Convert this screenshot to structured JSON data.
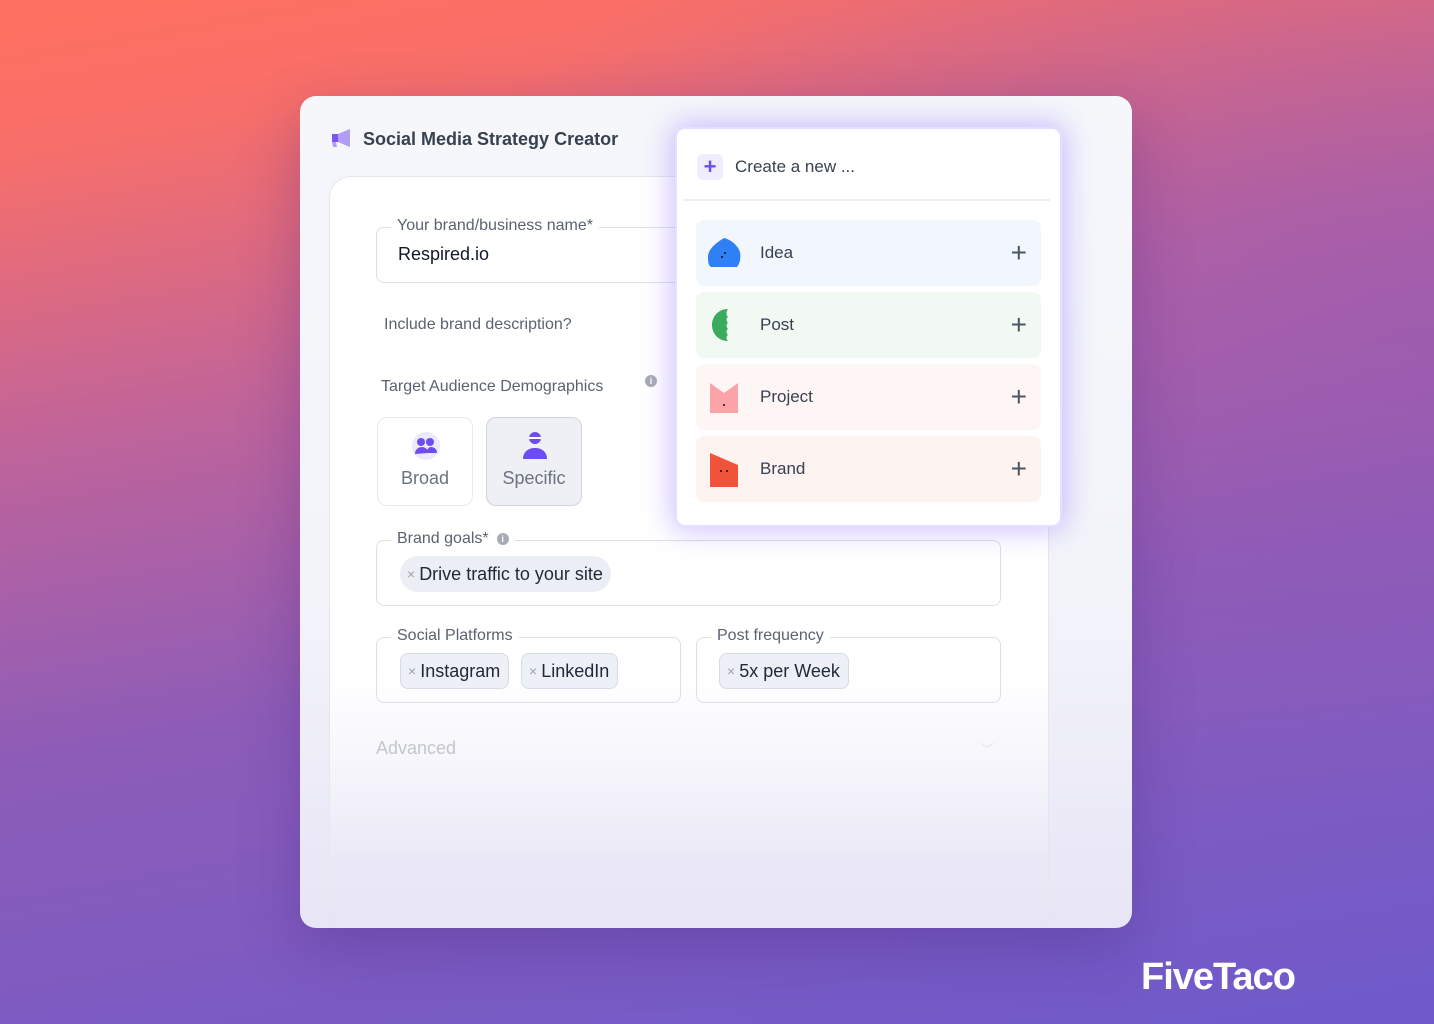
{
  "app": {
    "title": "Social Media Strategy Creator"
  },
  "form": {
    "brand_name": {
      "label": "Your brand/business name*",
      "value": "Respired.io"
    },
    "include_description": {
      "label": "Include brand description?"
    },
    "audience": {
      "label": "Target Audience Demographics",
      "options": [
        {
          "label": "Broad",
          "selected": false
        },
        {
          "label": "Specific",
          "selected": true
        }
      ]
    },
    "goals": {
      "label": "Brand goals*",
      "chips": [
        "Drive traffic to your site"
      ]
    },
    "platforms": {
      "label": "Social Platforms",
      "chips": [
        "Instagram",
        "LinkedIn"
      ]
    },
    "frequency": {
      "label": "Post frequency",
      "chips": [
        "5x per Week"
      ]
    },
    "advanced": {
      "label": "Advanced"
    }
  },
  "popup": {
    "header": "Create a new ...",
    "items": [
      {
        "label": "Idea",
        "color": "#2f7ff5",
        "bg": "#f2f6fd"
      },
      {
        "label": "Post",
        "color": "#3aaa5c",
        "bg": "#f2f9f3"
      },
      {
        "label": "Project",
        "color": "#fba3a8",
        "bg": "#fdf6f5"
      },
      {
        "label": "Brand",
        "color": "#f0533a",
        "bg": "#fdf3f1"
      }
    ]
  },
  "brand_logo": "FiveTaco",
  "colors": {
    "accent": "#6d4df2"
  }
}
